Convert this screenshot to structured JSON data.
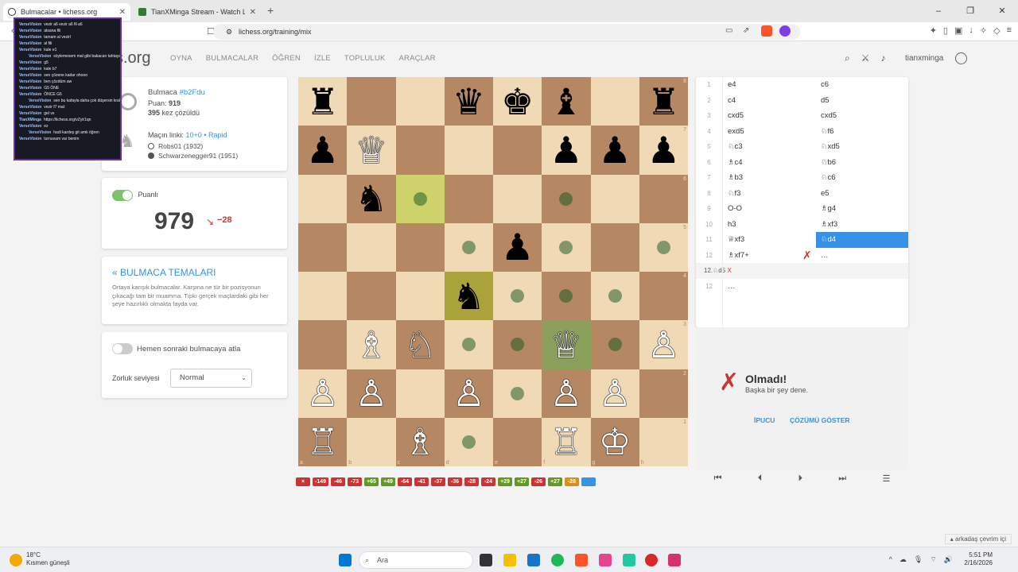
{
  "browser": {
    "tabs": [
      {
        "title": "Bulmacalar • lichess.org",
        "active": true
      },
      {
        "title": "TianXMinga Stream - Watch Live on",
        "active": false
      }
    ],
    "url": "lichess.org/training/mix"
  },
  "site": {
    "logo": "s.org",
    "nav": [
      "OYNA",
      "BULMACALAR",
      "ÖĞREN",
      "İZLE",
      "TOPLULUK",
      "ARAÇLAR"
    ],
    "username": "tianxminga"
  },
  "puzzle_info": {
    "title_prefix": "Bulmaca ",
    "puzzle_id": "#b2Fdu",
    "rating_label": "Puan: ",
    "rating": "919",
    "solved_count": "395",
    "solved_suffix": " kez çözüldü",
    "game_link_label": "Maçın linki: ",
    "game_link": "10+0 • Rapid",
    "white_player": "Robs01 (1932)",
    "black_player": "Schwarzenegger91 (1951)"
  },
  "rating_card": {
    "toggle_label": "Puanlı",
    "rating": "979",
    "delta": "−28"
  },
  "themes_card": {
    "title": "« BULMACA TEMALARI",
    "description": "Ortaya karışık bulmacalar. Karşına ne tür bir pozisyonun çıkacağı tam bir muamma. Tıpkı gerçek maçlardaki gibi her şeye hazırlıklı olmakta fayda var."
  },
  "settings_card": {
    "next_toggle_label": "Hemen sonraki bulmacaya atla",
    "difficulty_label": "Zorluk seviyesi",
    "difficulty_value": "Normal"
  },
  "board": {
    "position": [
      [
        "bR",
        "",
        "",
        "bQ",
        "bK",
        "bB",
        "",
        "bR"
      ],
      [
        "bP",
        "wQ",
        "",
        "",
        "",
        "bP",
        "bP",
        "bP"
      ],
      [
        "",
        "bN",
        "",
        "",
        "",
        "",
        "",
        ""
      ],
      [
        "",
        "",
        "",
        "",
        "bP",
        "",
        "",
        ""
      ],
      [
        "",
        "",
        "",
        "bN",
        "",
        "",
        "",
        ""
      ],
      [
        "",
        "wB",
        "wN",
        "",
        "",
        "wQ",
        "",
        "wP"
      ],
      [
        "wP",
        "wP",
        "",
        "wP",
        "",
        "wP",
        "wP",
        ""
      ],
      [
        "wR",
        "",
        "wB",
        "",
        "",
        "wR",
        "wK",
        ""
      ]
    ],
    "files": [
      "a",
      "b",
      "c",
      "d",
      "e",
      "f",
      "g",
      "h"
    ],
    "ranks": [
      "8",
      "7",
      "6",
      "5",
      "4",
      "3",
      "2",
      "1"
    ]
  },
  "result_strip": [
    {
      "text": "×",
      "color": "#cc3333"
    },
    {
      "text": "-149",
      "color": "#cc3333"
    },
    {
      "text": "-46",
      "color": "#cc3333"
    },
    {
      "text": "-73",
      "color": "#cc3333"
    },
    {
      "text": "+65",
      "color": "#629924"
    },
    {
      "text": "+49",
      "color": "#629924"
    },
    {
      "text": "-64",
      "color": "#cc3333"
    },
    {
      "text": "-41",
      "color": "#cc3333"
    },
    {
      "text": "-37",
      "color": "#cc3333"
    },
    {
      "text": "-36",
      "color": "#cc3333"
    },
    {
      "text": "-28",
      "color": "#cc3333"
    },
    {
      "text": "-24",
      "color": "#cc3333"
    },
    {
      "text": "+29",
      "color": "#629924"
    },
    {
      "text": "+27",
      "color": "#629924"
    },
    {
      "text": "-26",
      "color": "#cc3333"
    },
    {
      "text": "+27",
      "color": "#629924"
    },
    {
      "text": "-28",
      "color": "#d59020"
    },
    {
      "text": "",
      "color": "#3692e7"
    }
  ],
  "moves": [
    {
      "n": "1",
      "w": "e4",
      "b": "c6"
    },
    {
      "n": "2",
      "w": "c4",
      "b": "d5"
    },
    {
      "n": "3",
      "w": "cxd5",
      "b": "cxd5"
    },
    {
      "n": "4",
      "w": "exd5",
      "b": "♘f6"
    },
    {
      "n": "5",
      "w": "♘c3",
      "b": "♘xd5"
    },
    {
      "n": "6",
      "w": "♗c4",
      "b": "♘b6"
    },
    {
      "n": "7",
      "w": "♗b3",
      "b": "♘c6"
    },
    {
      "n": "8",
      "w": "♘f3",
      "b": "e5"
    },
    {
      "n": "9",
      "w": "O-O",
      "b": "♗g4"
    },
    {
      "n": "10",
      "w": "h3",
      "b": "♗xf3"
    },
    {
      "n": "11",
      "w": "♕xf3",
      "b": "♘d4"
    },
    {
      "n": "12",
      "w": "♗xf7+",
      "b": "…"
    }
  ],
  "variation": {
    "text": "12.♘d5",
    "mark": "X"
  },
  "extra_row": {
    "n": "12",
    "b": "…"
  },
  "feedback": {
    "mark": "X",
    "title": "Olmadı!",
    "subtitle": "Başka bir şey dene.",
    "hint": "İPUCU",
    "solution": "ÇÖZÜMÜ GÖSTER"
  },
  "chat_overlay": [
    {
      "user": "VerseVision",
      "msg": "vezir a6 vezir a6 fil a6"
    },
    {
      "user": "VerseVision",
      "msg": "atsana fili"
    },
    {
      "user": "VerseVision",
      "msg": "tamam al vezirl"
    },
    {
      "user": "VerseVision",
      "msg": "al fili"
    },
    {
      "user": "VerseVision",
      "msg": "kale e1"
    },
    {
      "user": "VerseVision",
      "msg": "söylemesem mal gibi bakacan tahtaya amk",
      "indent": true
    },
    {
      "user": "VerseVision",
      "msg": "g5"
    },
    {
      "user": "VerseVision",
      "msg": "kale b7"
    },
    {
      "user": "VerseVision",
      "msg": "sen çözene kadar ohooo"
    },
    {
      "user": "VerseVision",
      "msg": "ben çözdüm aw"
    },
    {
      "user": "VerseVision",
      "msg": "G5 ÖNE"
    },
    {
      "user": "VerseVision",
      "msg": "ÖNCE G5"
    },
    {
      "user": "VerseVision",
      "msg": "sen bu kafayla daha çok düşersin kral",
      "indent": true
    },
    {
      "user": "VerseVision",
      "msg": "vezir f7 mat"
    },
    {
      "user": "VerseVision",
      "msg": "gel vs"
    },
    {
      "user": "TianXMinga",
      "msg": "https://lichess.org/vZyir1qn"
    },
    {
      "user": "VerseVision",
      "msg": "ez"
    },
    {
      "user": "VerseVision",
      "msg": "hadi kardeş git amk öğren",
      "indent": true
    },
    {
      "user": "VerseVision",
      "msg": "turnuvam var benim"
    }
  ],
  "taskbar": {
    "weather_temp": "18°C",
    "weather_desc": "Kısmen güneşli",
    "search_placeholder": "Ara",
    "time": "5:51 PM",
    "date": "2/16/2026"
  },
  "friends_bar": "arkadaş çevrim içi"
}
